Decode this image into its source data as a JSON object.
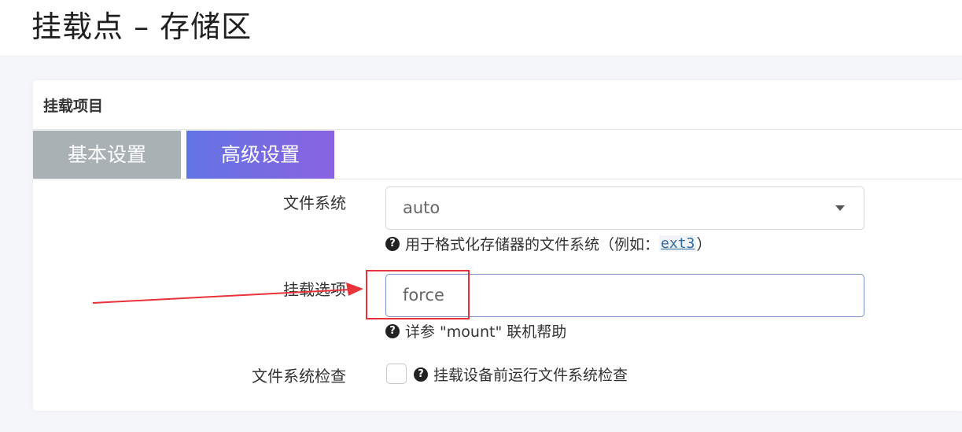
{
  "page": {
    "title": "挂载点 – 存储区"
  },
  "panel": {
    "title": "挂载项目"
  },
  "tabs": [
    {
      "label": "基本设置",
      "active": false
    },
    {
      "label": "高级设置",
      "active": true
    }
  ],
  "form": {
    "filesystem": {
      "label": "文件系统",
      "value": "auto",
      "help_prefix": "用于格式化存储器的文件系统（例如：",
      "help_code": "ext3",
      "help_suffix": "）"
    },
    "mount_options": {
      "label": "挂载选项",
      "value": "force",
      "help": "详参 \"mount\" 联机帮助"
    },
    "fs_check": {
      "label": "文件系统检查",
      "checked": false,
      "help": "挂载设备前运行文件系统检查"
    }
  },
  "icons": {
    "help": "question-circle-icon",
    "dropdown": "caret-down-icon"
  },
  "colors": {
    "tab_active_start": "#6274e3",
    "tab_active_end": "#8a63e1",
    "tab_inactive": "#aab1b5",
    "annotation_red": "#e8333a"
  }
}
